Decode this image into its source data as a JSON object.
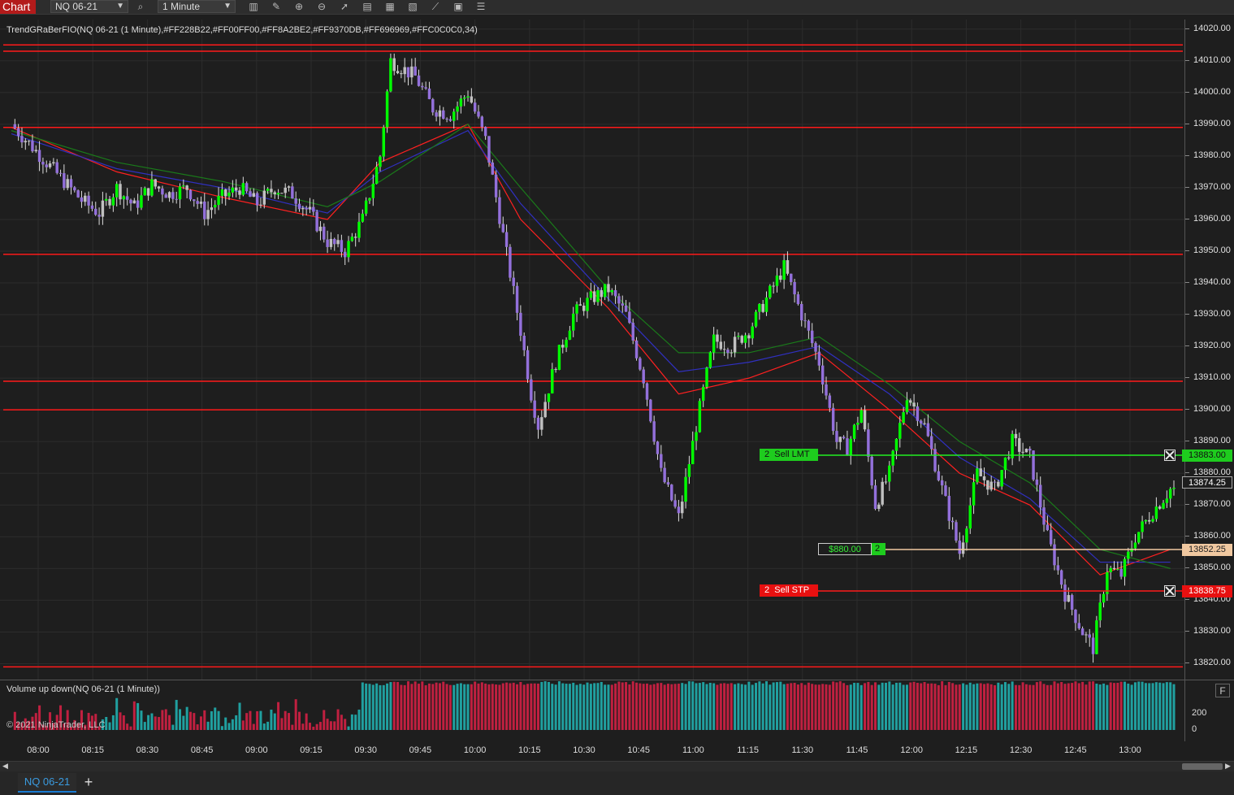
{
  "toolbar": {
    "tab_label": "Chart",
    "instrument": "NQ 06-21",
    "interval": "1 Minute",
    "icons": [
      "search-icon",
      "bar-type-icon",
      "draw-pencil-icon",
      "zoom-in-icon",
      "zoom-out-icon",
      "pointer-icon",
      "data-box-icon",
      "template-icon",
      "strategies-icon",
      "indicators-icon",
      "properties-icon",
      "chart-trader-icon"
    ]
  },
  "indicator": {
    "label": "TrendGRaBerFIO(NQ 06-21 (1 Minute),#FF228B22,#FF00FF00,#FF8A2BE2,#FF9370DB,#FF696969,#FFC0C0C0,34)"
  },
  "volume_panel": {
    "label": "Volume up down(NQ 06-21 (1 Minute))",
    "copyright": "© 2021 NinjaTrader, LLC",
    "ticks": [
      "200",
      "0"
    ],
    "f_button": "F"
  },
  "orders": {
    "sell_limit": {
      "qty": "2",
      "label": "Sell LMT",
      "price": "13883.00"
    },
    "position": {
      "pnl": "$880.00",
      "qty": "2",
      "price": "13852.25"
    },
    "sell_stop": {
      "qty": "2",
      "label": "Sell STP",
      "price": "13838.75"
    },
    "last_price": "13874.25"
  },
  "colors": {
    "up": "#00ff00",
    "down": "#9370db",
    "neutral": "#c0c0c0",
    "level_line": "#ff1a1a",
    "volume_up": "#20a0a0",
    "volume_down": "#c02040"
  },
  "bottom": {
    "instrument_tab": "NQ 06-21",
    "add_tab": "+"
  },
  "chart_data": {
    "type": "candlestick",
    "price_ticks": [
      "14020.00",
      "14010.00",
      "14000.00",
      "13990.00",
      "13980.00",
      "13970.00",
      "13960.00",
      "13950.00",
      "13940.00",
      "13930.00",
      "13920.00",
      "13910.00",
      "13900.00",
      "13890.00",
      "13880.00",
      "13870.00",
      "13860.00",
      "13850.00",
      "13840.00",
      "13830.00",
      "13820.00"
    ],
    "time_ticks": [
      "08:00",
      "08:15",
      "08:30",
      "08:45",
      "09:00",
      "09:15",
      "09:30",
      "09:45",
      "10:00",
      "10:15",
      "10:30",
      "10:45",
      "11:00",
      "11:15",
      "11:30",
      "11:45",
      "12:00",
      "12:15",
      "12:30",
      "12:45",
      "13:00"
    ],
    "levels": [
      14015,
      14013,
      13989,
      13949,
      13909,
      13900,
      13819
    ],
    "ylim": [
      13815,
      14023
    ],
    "path": [
      [
        0,
        13990
      ],
      [
        5,
        13984
      ],
      [
        10,
        13978
      ],
      [
        15,
        13972
      ],
      [
        20,
        13966
      ],
      [
        25,
        13962
      ],
      [
        30,
        13970
      ],
      [
        35,
        13964
      ],
      [
        40,
        13971
      ],
      [
        45,
        13968
      ],
      [
        50,
        13970
      ],
      [
        55,
        13962
      ],
      [
        60,
        13967
      ],
      [
        65,
        13970
      ],
      [
        70,
        13965
      ],
      [
        75,
        13970
      ],
      [
        80,
        13968
      ],
      [
        85,
        13962
      ],
      [
        90,
        13953
      ],
      [
        95,
        13950
      ],
      [
        100,
        13960
      ],
      [
        105,
        13980
      ],
      [
        108,
        14010
      ],
      [
        115,
        14005
      ],
      [
        120,
        13995
      ],
      [
        125,
        13993
      ],
      [
        130,
        14000
      ],
      [
        135,
        13985
      ],
      [
        140,
        13955
      ],
      [
        145,
        13925
      ],
      [
        148,
        13905
      ],
      [
        150,
        13895
      ],
      [
        155,
        13915
      ],
      [
        160,
        13930
      ],
      [
        165,
        13935
      ],
      [
        170,
        13938
      ],
      [
        175,
        13930
      ],
      [
        180,
        13910
      ],
      [
        185,
        13880
      ],
      [
        190,
        13866
      ],
      [
        195,
        13895
      ],
      [
        200,
        13922
      ],
      [
        205,
        13920
      ],
      [
        210,
        13925
      ],
      [
        215,
        13935
      ],
      [
        220,
        13945
      ],
      [
        225,
        13930
      ],
      [
        230,
        13915
      ],
      [
        235,
        13890
      ],
      [
        238,
        13888
      ],
      [
        242,
        13900
      ],
      [
        246,
        13870
      ],
      [
        250,
        13880
      ],
      [
        255,
        13905
      ],
      [
        260,
        13895
      ],
      [
        265,
        13875
      ],
      [
        270,
        13855
      ],
      [
        275,
        13880
      ],
      [
        280,
        13875
      ],
      [
        285,
        13890
      ],
      [
        290,
        13885
      ],
      [
        295,
        13860
      ],
      [
        300,
        13842
      ],
      [
        305,
        13830
      ],
      [
        308,
        13825
      ],
      [
        312,
        13850
      ],
      [
        316,
        13848
      ],
      [
        320,
        13860
      ],
      [
        325,
        13868
      ],
      [
        330,
        13875
      ]
    ],
    "avg_lines": [
      {
        "color": "#ff2020",
        "points": [
          [
            0,
            13989
          ],
          [
            30,
            13975
          ],
          [
            60,
            13967
          ],
          [
            90,
            13960
          ],
          [
            105,
            13978
          ],
          [
            130,
            13990
          ],
          [
            145,
            13960
          ],
          [
            170,
            13932
          ],
          [
            190,
            13905
          ],
          [
            210,
            13910
          ],
          [
            230,
            13918
          ],
          [
            250,
            13900
          ],
          [
            270,
            13880
          ],
          [
            290,
            13870
          ],
          [
            310,
            13848
          ],
          [
            330,
            13856
          ]
        ]
      },
      {
        "color": "#3030c0",
        "points": [
          [
            0,
            13987
          ],
          [
            30,
            13976
          ],
          [
            60,
            13970
          ],
          [
            90,
            13962
          ],
          [
            105,
            13975
          ],
          [
            130,
            13988
          ],
          [
            145,
            13965
          ],
          [
            170,
            13935
          ],
          [
            190,
            13912
          ],
          [
            210,
            13915
          ],
          [
            230,
            13920
          ],
          [
            250,
            13905
          ],
          [
            270,
            13885
          ],
          [
            290,
            13872
          ],
          [
            310,
            13852
          ],
          [
            330,
            13852
          ]
        ]
      },
      {
        "color": "#1a7a1a",
        "points": [
          [
            0,
            13988
          ],
          [
            30,
            13978
          ],
          [
            60,
            13972
          ],
          [
            90,
            13964
          ],
          [
            105,
            13972
          ],
          [
            130,
            13990
          ],
          [
            145,
            13970
          ],
          [
            170,
            13938
          ],
          [
            190,
            13918
          ],
          [
            210,
            13918
          ],
          [
            230,
            13923
          ],
          [
            250,
            13908
          ],
          [
            270,
            13890
          ],
          [
            290,
            13877
          ],
          [
            310,
            13856
          ],
          [
            330,
            13850
          ]
        ]
      }
    ]
  }
}
